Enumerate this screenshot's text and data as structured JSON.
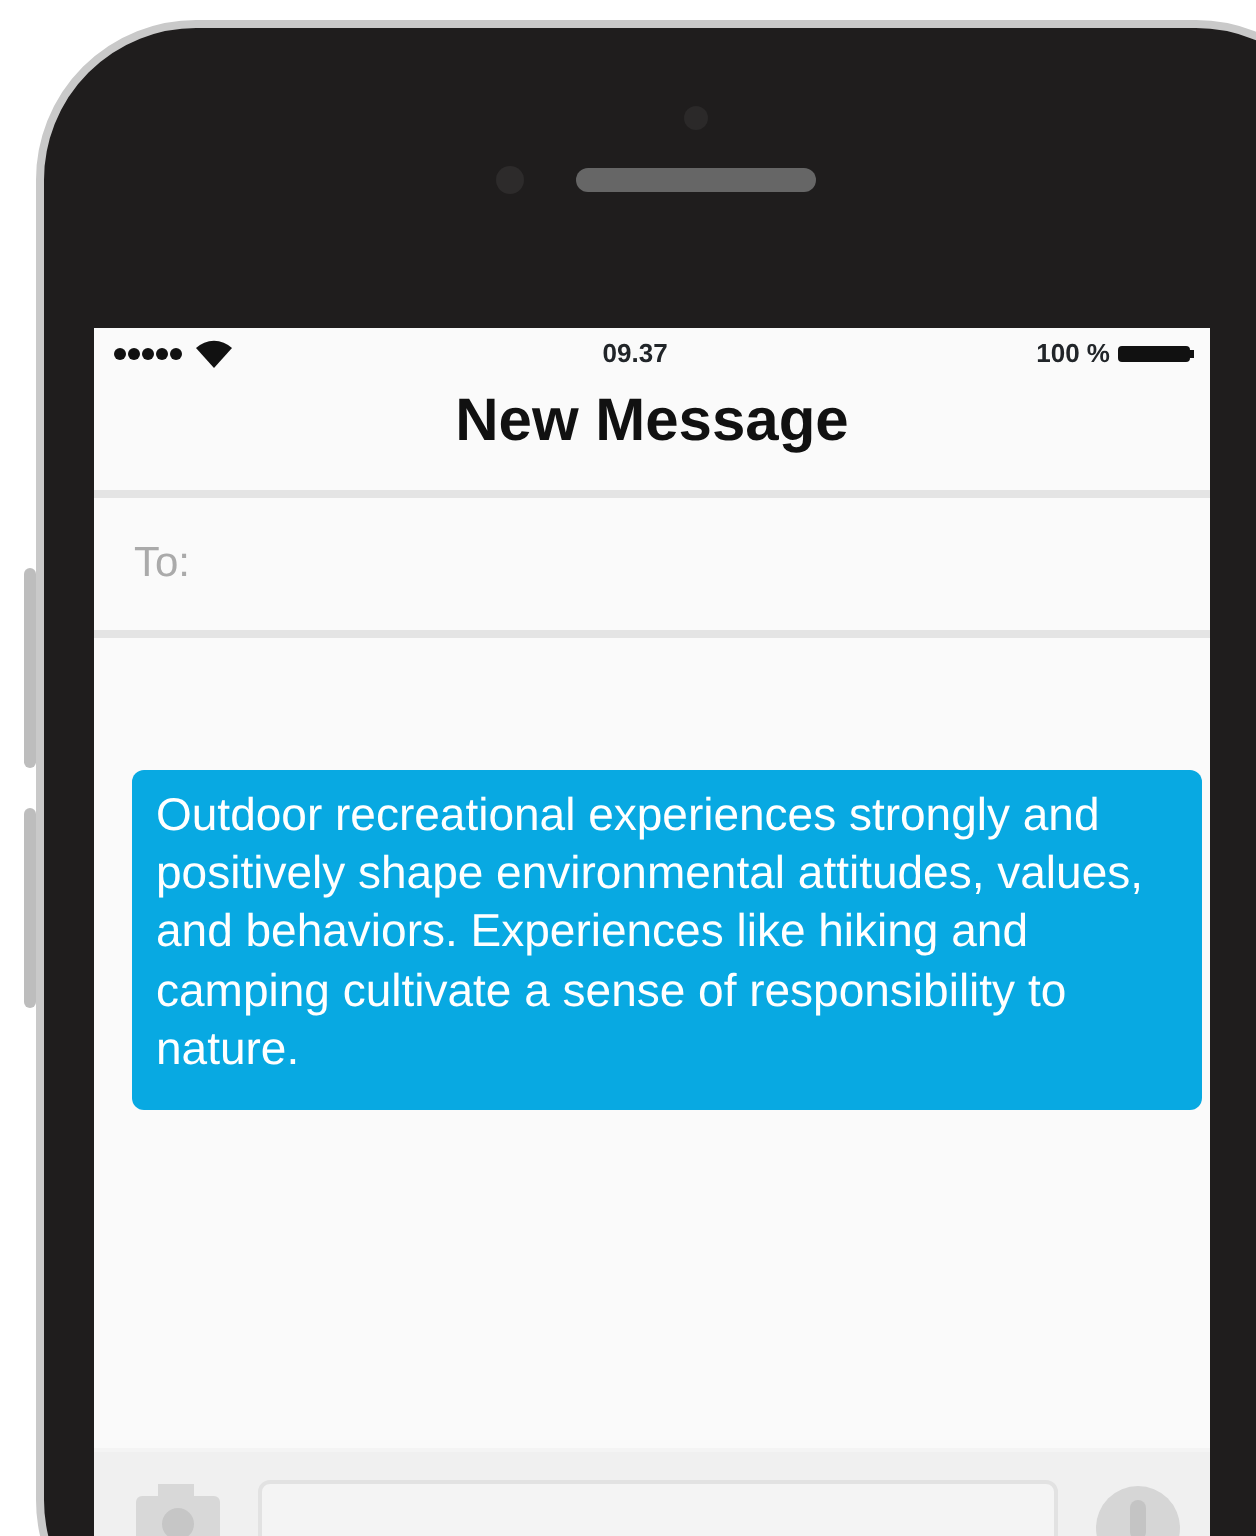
{
  "status_bar": {
    "time": "09.37",
    "battery": "100 %"
  },
  "title": "New Message",
  "to_field": {
    "label": "To:"
  },
  "message": {
    "text": "Outdoor recreational experiences strongly and positively shape environmental attitudes, values, and behaviors. Experiences like hiking and camping cultivate a sense of responsibility to nature."
  }
}
